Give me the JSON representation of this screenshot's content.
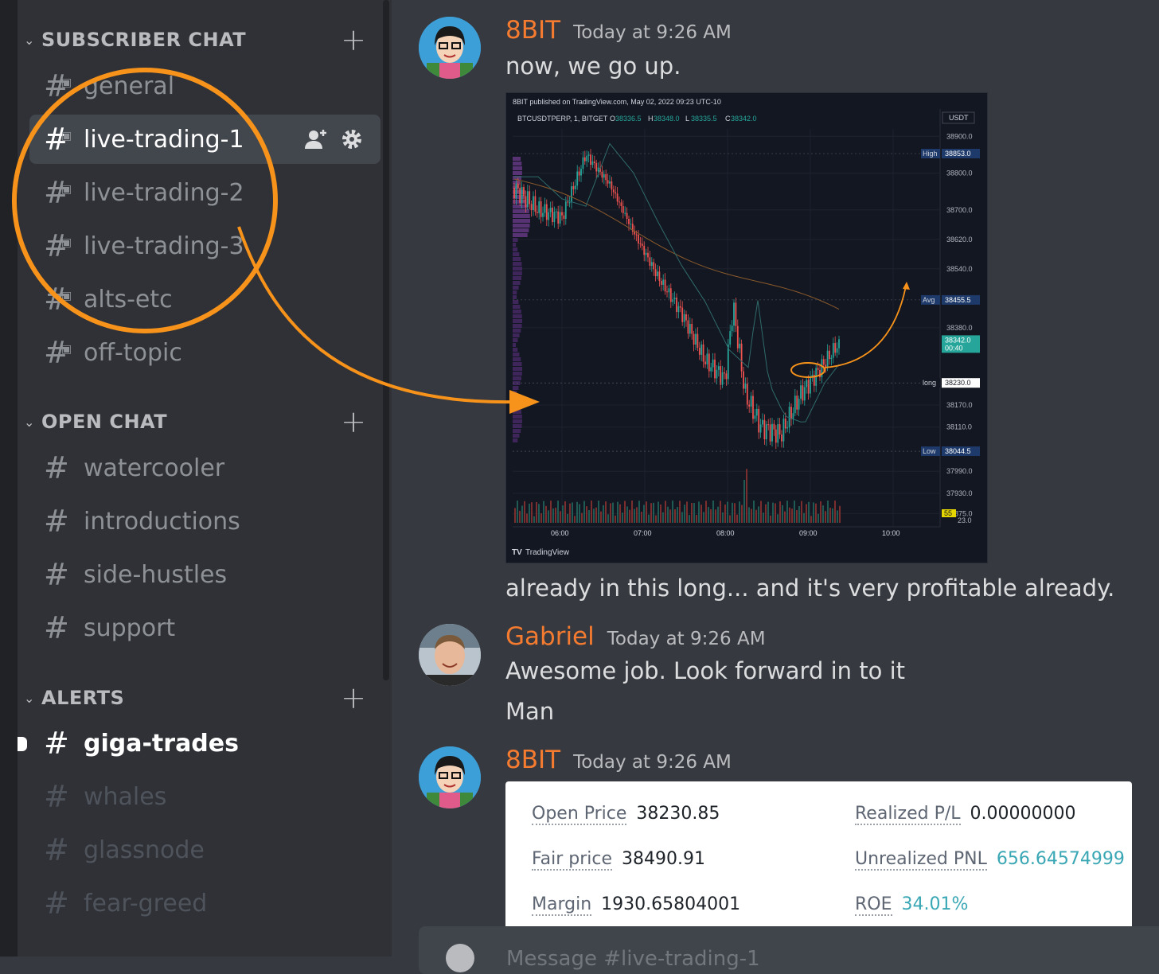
{
  "sidebar": {
    "categories": [
      {
        "name": "SUBSCRIBER CHAT"
      },
      {
        "name": "OPEN CHAT"
      },
      {
        "name": "ALERTS"
      }
    ],
    "subscriber_channels": [
      "general",
      "live-trading-1",
      "live-trading-2",
      "live-trading-3",
      "alts-etc",
      "off-topic"
    ],
    "open_channels": [
      "watercooler",
      "introductions",
      "side-hustles",
      "support"
    ],
    "alert_channels": [
      "giga-trades",
      "whales",
      "glassnode",
      "fear-greed"
    ],
    "active_channel": "live-trading-1",
    "unread_channel": "giga-trades",
    "colors": {
      "accent_annotation": "#f7931a",
      "author": "#f47b30"
    }
  },
  "messages": [
    {
      "author": "8BIT",
      "timestamp": "Today at 9:26 AM",
      "lines": [
        "now, we go up."
      ],
      "after_image": "already in this long... and it's very profitable already."
    },
    {
      "author": "Gabriel",
      "timestamp": "Today at 9:26 AM",
      "lines": [
        "Awesome job. Look forward in to it",
        "Man"
      ]
    },
    {
      "author": "8BIT",
      "timestamp": "Today at 9:26 AM"
    }
  ],
  "chart": {
    "published": "8BIT published on TradingView.com, May 02, 2022 09:23 UTC-10",
    "symbol": "BTCUSDTPERP, 1, BITGET",
    "ohlc": {
      "o_label": "O",
      "o": "38336.5",
      "h_label": "H",
      "h": "38348.0",
      "l_label": "L",
      "l": "38335.5",
      "c_label": "C",
      "c": "38342.0"
    },
    "currency": "USDT",
    "price_ticks": [
      "38900.0",
      "38800.0",
      "38700.0",
      "38620.0",
      "38540.0",
      "38380.0",
      "38170.0",
      "38110.0",
      "37990.0",
      "37930.0",
      "37875.0"
    ],
    "tags": {
      "high_label": "High",
      "high": "38853.0",
      "avg_label": "Avg",
      "avg": "38455.5",
      "last": "38342.0",
      "last_timer": "00:40",
      "long_label": "long",
      "long": "38230.0",
      "low_label": "Low",
      "low": "38044.5",
      "vol_tag": "55",
      "partial_tick": "23.0"
    },
    "time_ticks": [
      "06:00",
      "07:00",
      "08:00",
      "09:00",
      "10:00"
    ],
    "brand": "TradingView"
  },
  "position": {
    "open_price_label": "Open Price",
    "open_price": "38230.85",
    "fair_price_label": "Fair price",
    "fair_price": "38490.91",
    "margin_label": "Margin",
    "margin": "1930.65804001",
    "realized_label": "Realized P/L",
    "realized": "0.00000000",
    "unrealized_label": "Unrealized PNL",
    "unrealized": "656.64574999",
    "roe_label": "ROE",
    "roe": "34.01%"
  },
  "input": {
    "placeholder": "Message #live-trading-1"
  }
}
